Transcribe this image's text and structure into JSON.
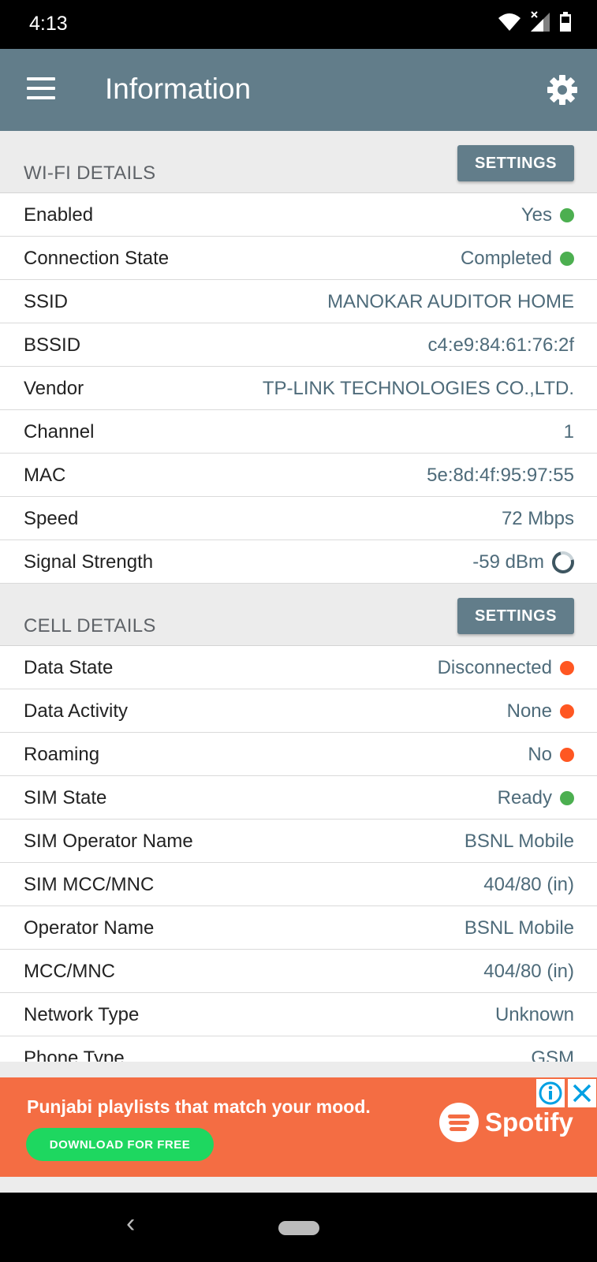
{
  "status_bar": {
    "time": "4:13"
  },
  "app_bar": {
    "title": "Information"
  },
  "wifi": {
    "header": "WI-FI DETAILS",
    "settings_label": "SETTINGS",
    "rows": [
      {
        "label": "Enabled",
        "value": "Yes",
        "indicator": "green"
      },
      {
        "label": "Connection State",
        "value": "Completed",
        "indicator": "green"
      },
      {
        "label": "SSID",
        "value": "MANOKAR AUDITOR HOME"
      },
      {
        "label": "BSSID",
        "value": "c4:e9:84:61:76:2f"
      },
      {
        "label": "Vendor",
        "value": "TP-LINK TECHNOLOGIES CO.,LTD."
      },
      {
        "label": "Channel",
        "value": "1"
      },
      {
        "label": "MAC",
        "value": "5e:8d:4f:95:97:55"
      },
      {
        "label": "Speed",
        "value": "72 Mbps"
      },
      {
        "label": "Signal Strength",
        "value": "-59 dBm",
        "indicator": "ring"
      }
    ]
  },
  "cell": {
    "header": "CELL DETAILS",
    "settings_label": "SETTINGS",
    "rows": [
      {
        "label": "Data State",
        "value": "Disconnected",
        "indicator": "orange"
      },
      {
        "label": "Data Activity",
        "value": "None",
        "indicator": "orange"
      },
      {
        "label": "Roaming",
        "value": "No",
        "indicator": "orange"
      },
      {
        "label": "SIM State",
        "value": "Ready",
        "indicator": "green"
      },
      {
        "label": "SIM Operator Name",
        "value": "BSNL Mobile"
      },
      {
        "label": "SIM MCC/MNC",
        "value": "404/80 (in)"
      },
      {
        "label": "Operator Name",
        "value": "BSNL Mobile"
      },
      {
        "label": "MCC/MNC",
        "value": "404/80 (in)"
      },
      {
        "label": "Network Type",
        "value": "Unknown"
      },
      {
        "label": "Phone Type",
        "value": "GSM"
      }
    ]
  },
  "ad": {
    "headline": "Punjabi playlists that match your mood.",
    "cta": "DOWNLOAD FOR FREE",
    "brand": "Spotify"
  },
  "colors": {
    "accent": "#627d8a",
    "value_text": "#4e6b7a",
    "green": "#4caf50",
    "orange": "#ff5722",
    "ad_bg": "#f46d43"
  }
}
